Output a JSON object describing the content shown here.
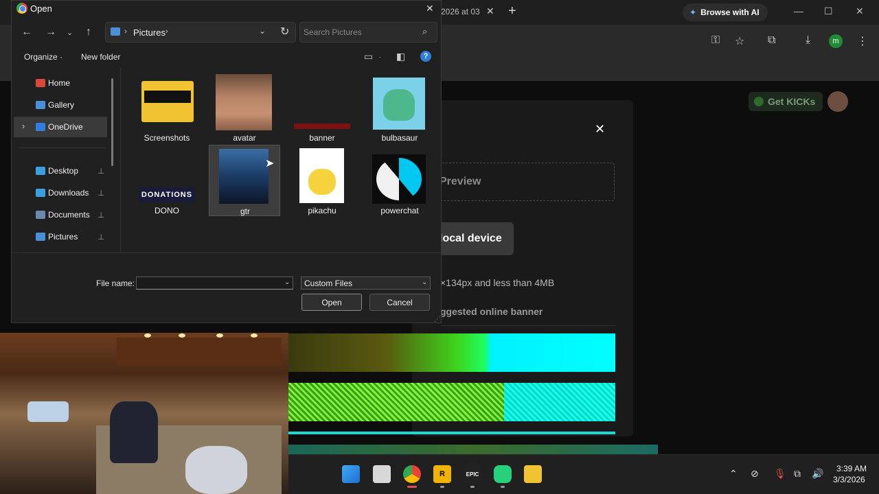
{
  "browser": {
    "tab_title": "2026 at 03",
    "tab_close": "✕",
    "new_tab": "+",
    "browse_ai_icon": "sparkle-icon",
    "browse_ai_label": "Browse with AI",
    "win_min": "—",
    "win_max": "☐",
    "win_close": "✕",
    "profile_initial": "m"
  },
  "page": {
    "get_kicks_label": "Get KICKs",
    "modal": {
      "close": "✕",
      "preview_label": "Preview",
      "local_device_button": "local device",
      "size_note": "×134px and less than 4MB",
      "suggested_heading": "ggested online banner"
    }
  },
  "dialog": {
    "title": "Open",
    "close": "✕",
    "address": {
      "location": "Pictures",
      "sep": "›"
    },
    "search_placeholder": "Search Pictures",
    "organize_label": "Organize",
    "new_folder_label": "New folder",
    "help": "?",
    "sidebar": [
      {
        "label": "Home",
        "icon": "home-icon",
        "color": "#d94a3a",
        "pinned": false,
        "selected": false
      },
      {
        "label": "Gallery",
        "icon": "gallery-icon",
        "color": "#4a8fd8",
        "pinned": false,
        "selected": false
      },
      {
        "label": "OneDrive",
        "icon": "cloud-icon",
        "color": "#2f7fe0",
        "pinned": false,
        "selected": true
      },
      {
        "label": "Desktop",
        "icon": "desktop-icon",
        "color": "#3aa0e0",
        "pinned": true,
        "selected": false
      },
      {
        "label": "Downloads",
        "icon": "downloads-icon",
        "color": "#3aa0e0",
        "pinned": true,
        "selected": false
      },
      {
        "label": "Documents",
        "icon": "documents-icon",
        "color": "#6a8ab0",
        "pinned": true,
        "selected": false
      },
      {
        "label": "Pictures",
        "icon": "pictures-icon",
        "color": "#4a8fd8",
        "pinned": true,
        "selected": false
      }
    ],
    "pin_glyph": "📌",
    "files": [
      {
        "name": "Screenshots"
      },
      {
        "name": "avatar"
      },
      {
        "name": "banner"
      },
      {
        "name": "bulbasaur"
      },
      {
        "name": "DONO"
      },
      {
        "name": "gtr"
      },
      {
        "name": "pikachu"
      },
      {
        "name": "powerchat"
      }
    ],
    "dono_text": "DONATIONS",
    "file_name_label": "File name:",
    "file_name_value": "",
    "file_type_value": "Custom Files",
    "open_button": "Open",
    "cancel_button": "Cancel"
  },
  "taskbar": {
    "apps": [
      {
        "name": "start-icon"
      },
      {
        "name": "task-view-icon"
      },
      {
        "name": "chrome-icon"
      },
      {
        "name": "rockstar-icon",
        "text": "R"
      },
      {
        "name": "epic-games-icon",
        "text": "EPIC"
      },
      {
        "name": "game-launcher-icon"
      },
      {
        "name": "file-explorer-icon"
      }
    ],
    "clock_time": "3:39 AM",
    "clock_date": "3/3/2026"
  }
}
